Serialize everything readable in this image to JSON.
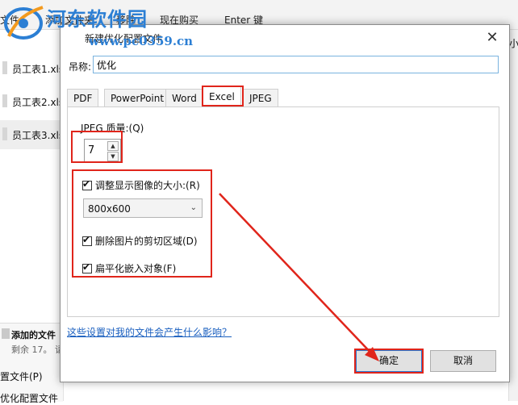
{
  "background": {
    "toolbar": [
      "文件",
      "添加文件夹",
      "移除",
      "现在购买",
      "Enter 键"
    ],
    "files": [
      "员工表1.xls",
      "员工表2.xls",
      "员工表3.xls"
    ],
    "bottom_status_title": "添加的文件",
    "bottom_status_sub": "剩余 17。 请",
    "bottom_label1": "置文件(P)",
    "bottom_label2": "优化配置文件",
    "right_edge_text": "小"
  },
  "watermark": {
    "title": "河东软件园",
    "url": "www.pc0359.cn"
  },
  "dialog": {
    "title": "新建优化配置文件",
    "name_label": "吊称:",
    "name_value": "优化",
    "tabs": [
      "PDF",
      "PowerPoint",
      "Word",
      "Excel",
      "JPEG"
    ],
    "active_tab": "Excel",
    "jpeg_quality_label": "JPEG 质量:(Q)",
    "jpeg_quality_value": "7",
    "resize_label": "调整显示图像的大小:(R)",
    "resize_checked": true,
    "resolution_value": "800x600",
    "crop_label": "删除图片的剪切区域(D)",
    "crop_checked": true,
    "flatten_label": "扁平化嵌入对象(F)",
    "flatten_checked": true,
    "help_link": "这些设置对我的文件会产生什么影响？",
    "ok_label": "确定",
    "cancel_label": "取消"
  },
  "annotation_color": "#e0251b",
  "watermark_color": "#2c7fd4"
}
